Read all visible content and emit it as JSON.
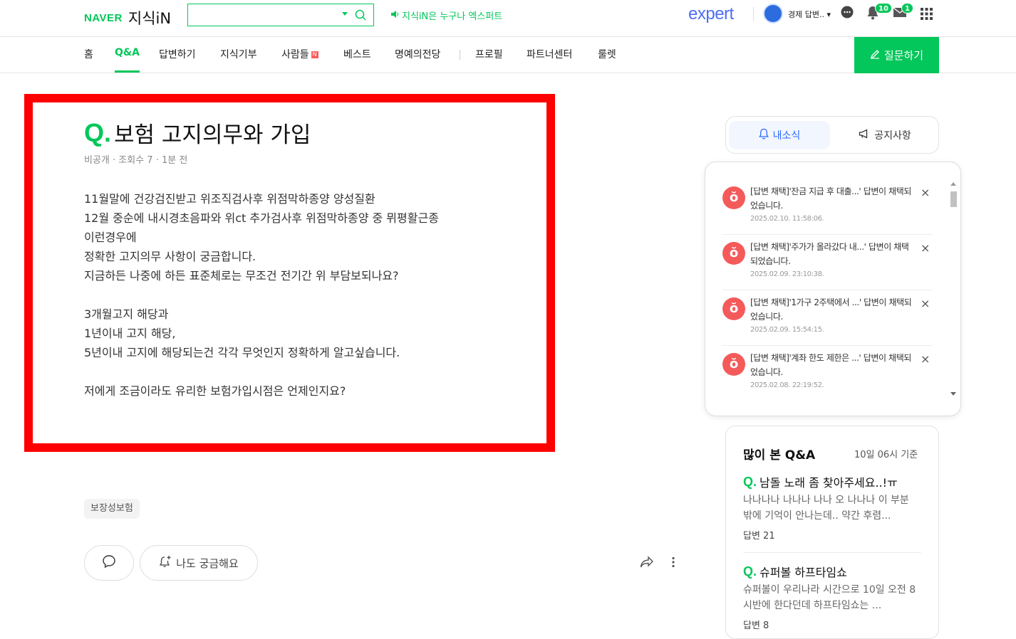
{
  "header": {
    "brand": "NAVER",
    "service": "지식iN",
    "search_placeholder": "",
    "promo": "지식iN은 누구나 엑스퍼트",
    "expert_logo": "expert",
    "username": "경제 답변..",
    "alarm_count": "10",
    "mail_count": "1",
    "accent": "#03c75a"
  },
  "nav": {
    "items": [
      "홈",
      "Q&A",
      "답변하기",
      "지식기부",
      "사람들",
      "베스트",
      "명예의전당",
      "프로필",
      "파트너센터",
      "룰렛"
    ],
    "active": "Q&A",
    "new_badge": "N",
    "ask_button": "질문하기"
  },
  "question": {
    "q_mark": "Q.",
    "title": "보험 고지의무와 가입",
    "meta": "비공개 · 조회수 7 · 1분 전",
    "body": [
      "11월말에 건강검진받고 위조직검사후 위점막하종양 양성질환",
      "12월 중순에 내시경초음파와 위ct 추가검사후 위점막하종양 중 뮈평활근종",
      "이런경우에",
      "정확한 고지의무 사항이 궁금합니다.",
      "지금하든 나중에 하든 표준체로는 무조건 전기간 위 부담보되나요?",
      "",
      "3개월고지 해당과",
      "1년이내 고지 해당,",
      "5년이내 고지에 해당되는건 각각 무엇인지 정확하게 알고싶습니다.",
      "",
      "저에게 조금이라도 유리한 보험가입시점은 언제인지요?"
    ],
    "tag": "보장성보험",
    "curious_label": "나도 궁금해요"
  },
  "side": {
    "tab_news": "내소식",
    "tab_notice": "공지사항",
    "notifications": [
      {
        "text": "[답변 채택]'잔금 지급 후 대출...' 답변이 채택되었습니다.",
        "date": "2025.02.10. 11:58:06."
      },
      {
        "text": "[답변 채택]'주가가 올라갔다 내...' 답변이 채택되었습니다.",
        "date": "2025.02.09. 23:10:38."
      },
      {
        "text": "[답변 채택]'1가구 2주택에서 ...' 답변이 채택되었습니다.",
        "date": "2025.02.09. 15:54:15."
      },
      {
        "text": "[답변 채택]'계좌 한도 제한은 ...' 답변이 채택되었습니다.",
        "date": "2025.02.08. 22:19:52."
      }
    ],
    "popular_title": "많이 본 Q&A",
    "popular_time": "10일 06시 기준",
    "popular": [
      {
        "title": "남돌 노래 좀 찾아주세요..!ㅠ",
        "desc": "나나나나 나나나 나나 오 나나나 이 부분 밖에 기억이 안나는데.. 약간 후렴...",
        "answers": "답변 21"
      },
      {
        "title": "슈퍼볼 하프타임쇼",
        "desc": "슈퍼볼이 우리나라 시간으로 10일 오전 8시반에 한다던데 하프타임쇼는 ...",
        "answers": "답변 8"
      }
    ]
  }
}
